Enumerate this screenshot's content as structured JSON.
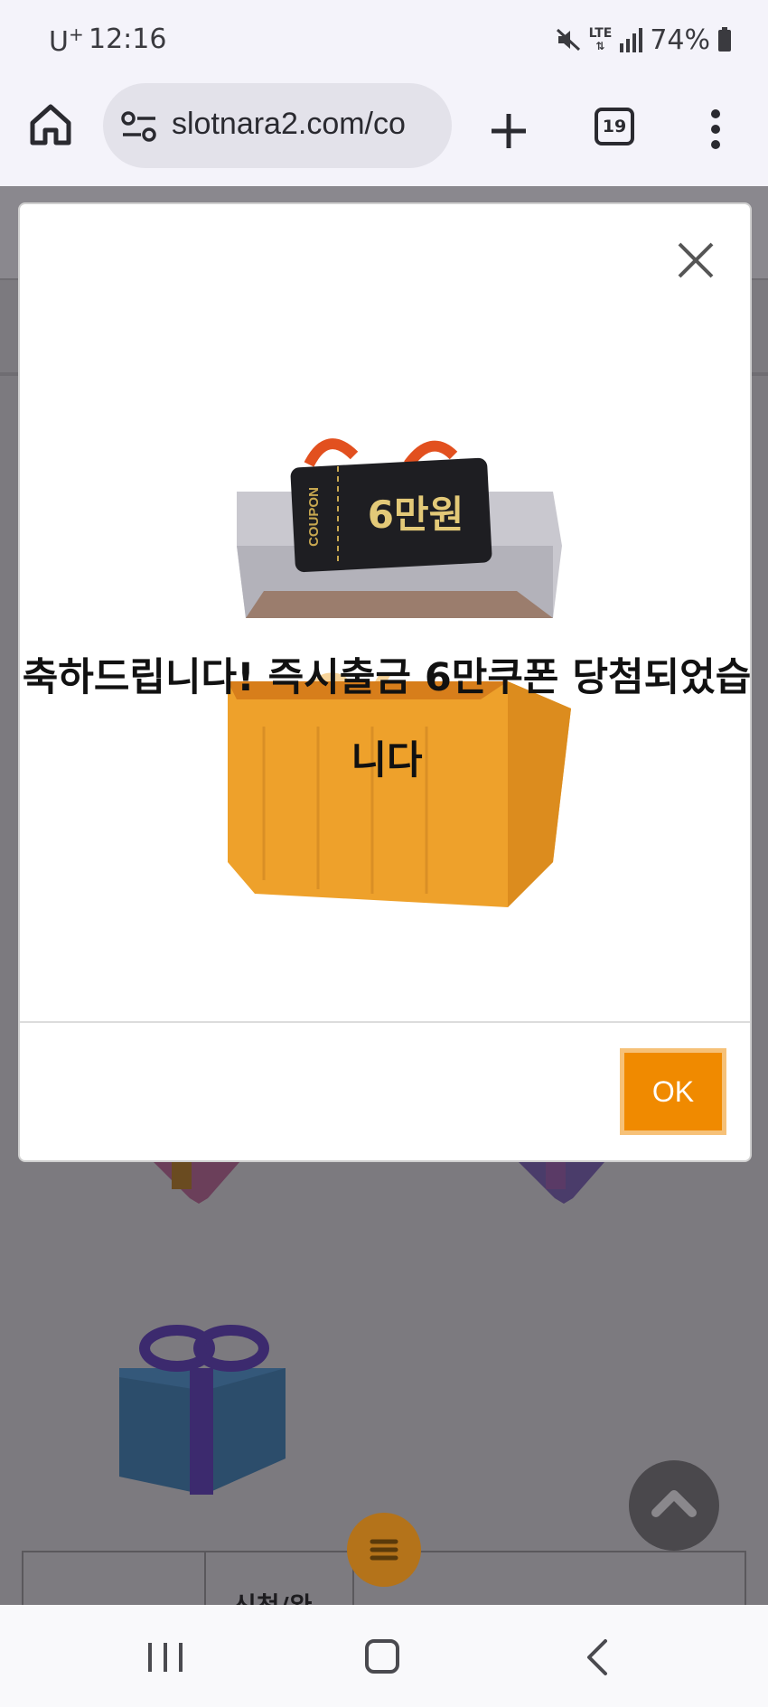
{
  "status_bar": {
    "carrier": "U",
    "carrier_sup": "+",
    "time": "12:16",
    "network": "LTE",
    "battery": "74%"
  },
  "browser": {
    "url": "slotnara2.com/co",
    "tab_count": "19",
    "icons": [
      "home-icon",
      "site-settings-icon",
      "new-tab-icon",
      "tab-switcher-icon",
      "more-icon"
    ]
  },
  "modal": {
    "coupon_label": "COUPON",
    "coupon_amount": "6만원",
    "percent_symbol": "%",
    "message": "축하드립니다! 즉시출금 6만쿠폰 당첨되었습니다",
    "ok_label": "OK",
    "accent_color": "#f08a00"
  },
  "background_page": {
    "table_cell_text": "신청/완"
  }
}
